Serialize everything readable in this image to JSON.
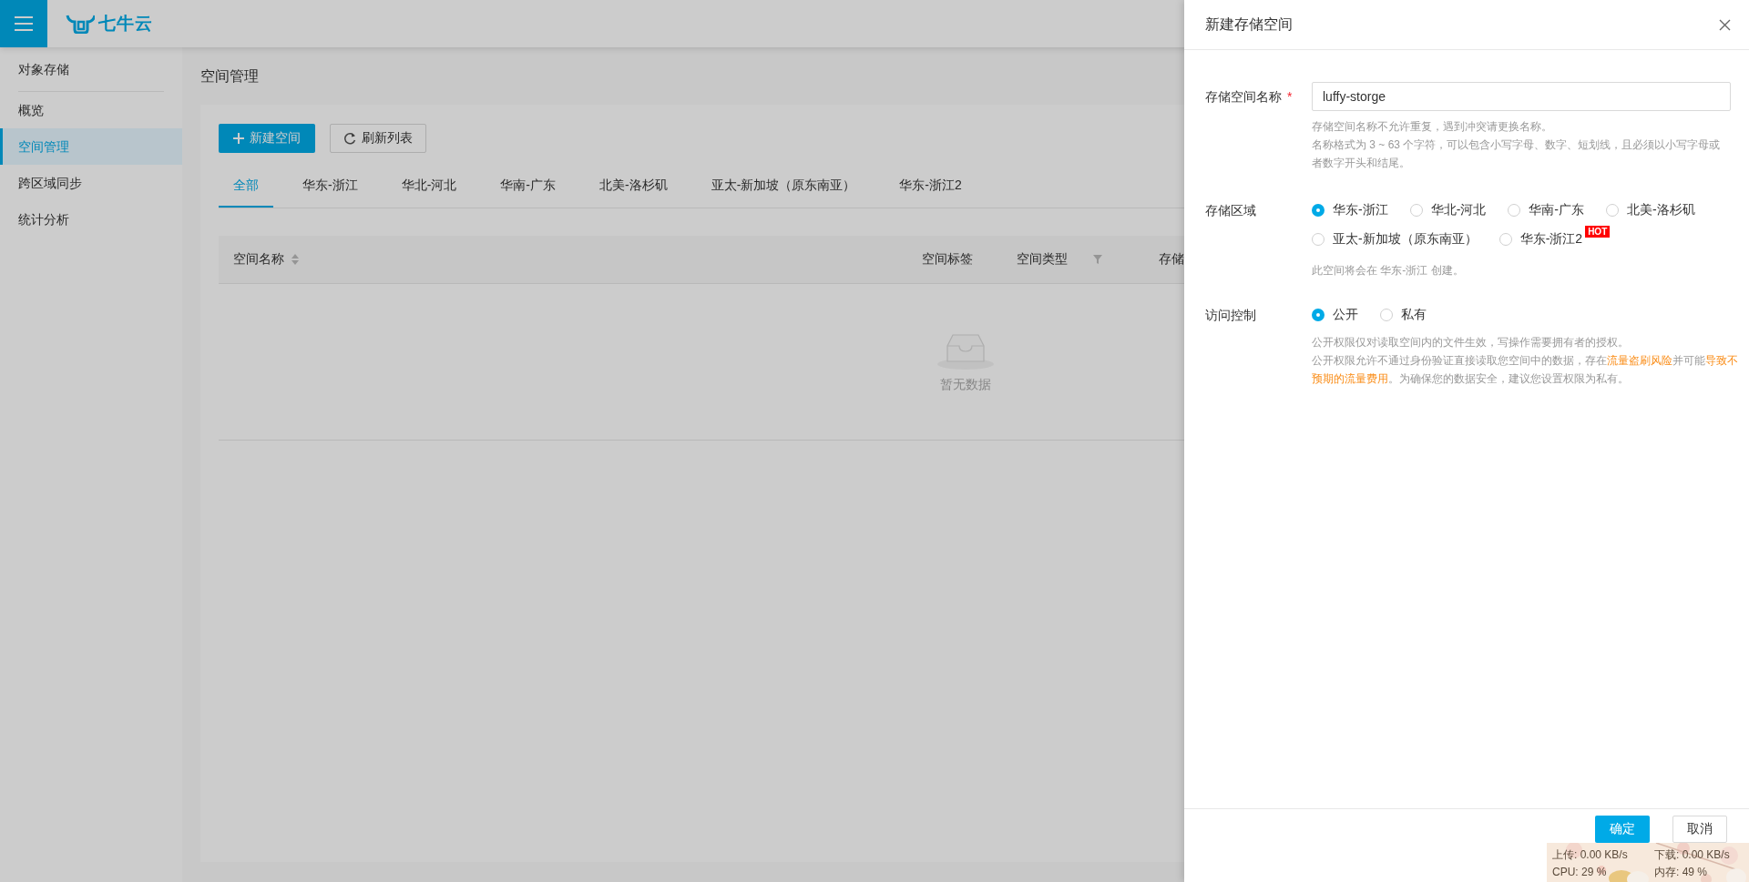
{
  "header": {
    "logo_text": "七牛云"
  },
  "sidebar": {
    "title": "对象存储",
    "items": [
      {
        "label": "概览",
        "selected": false
      },
      {
        "label": "空间管理",
        "selected": true
      },
      {
        "label": "跨区域同步",
        "selected": false
      },
      {
        "label": "统计分析",
        "selected": false
      }
    ]
  },
  "page": {
    "title": "空间管理",
    "buttons": [
      {
        "label": "新建空间",
        "kind": "primary"
      },
      {
        "label": "刷新列表",
        "kind": "refresh"
      }
    ],
    "tabs": [
      {
        "label": "全部",
        "selected": true
      },
      {
        "label": "华东-浙江",
        "selected": false
      },
      {
        "label": "华北-河北",
        "selected": false
      },
      {
        "label": "华南-广东",
        "selected": false
      },
      {
        "label": "北美-洛杉矶",
        "selected": false
      },
      {
        "label": "亚太-新加坡（原东南亚）",
        "selected": false
      },
      {
        "label": "华东-浙江2",
        "selected": false
      }
    ],
    "table": {
      "columns": [
        {
          "label": "空间名称",
          "kind": "sort"
        },
        {
          "label": "空间标签",
          "kind": "plain"
        },
        {
          "label": "空间类型",
          "kind": "filter"
        },
        {
          "label": "存储",
          "kind": "plain"
        }
      ],
      "empty_text": "暂无数据"
    }
  },
  "drawer": {
    "title": "新建存储空间",
    "name_field": {
      "label": "存储空间名称",
      "required_mark": "*",
      "value": "luffy-storge",
      "help": [
        "存储空间名称不允许重复，遇到冲突请更换名称。",
        "名称格式为 3 ~ 63 个字符，可以包含小写字母、数字、短划线，且必须以小写字母或者数字开头和结尾。"
      ]
    },
    "region": {
      "label": "存储区域",
      "options": [
        {
          "label": "华东-浙江",
          "selected": true
        },
        {
          "label": "华北-河北",
          "selected": false
        },
        {
          "label": "华南-广东",
          "selected": false
        },
        {
          "label": "北美-洛杉矶",
          "selected": false
        },
        {
          "label": "亚太-新加坡（原东南亚）",
          "selected": false
        },
        {
          "label": "华东-浙江2",
          "selected": false,
          "badge": "HOT"
        }
      ],
      "note": "此空间将会在 华东-浙江 创建。"
    },
    "access": {
      "label": "访问控制",
      "options": [
        {
          "label": "公开",
          "selected": true
        },
        {
          "label": "私有",
          "selected": false
        }
      ],
      "help": [
        [
          {
            "text": "公开权限仅对读取空间内的文件生效，写操作需要拥有者的授权。",
            "warning": false
          }
        ],
        [
          {
            "text": "公开权限允许不通过身份验证直接读取您空间中的数据，存在",
            "warning": false
          },
          {
            "text": "流量盗刷风险",
            "warning": true
          },
          {
            "text": "并可能",
            "warning": false
          },
          {
            "text": "导致不预期的流量费用",
            "warning": true
          },
          {
            "text": "。为确保您的数据安全，建议您设置权限为私有。",
            "warning": false
          }
        ]
      ]
    },
    "buttons": [
      {
        "label": "确定",
        "kind": "primary"
      },
      {
        "label": "取消",
        "kind": "default"
      }
    ]
  },
  "net_monitor": {
    "upload": "上传: 0.00 KB/s",
    "download": "下载: 0.00 KB/s",
    "cpu": "CPU: 29 %",
    "memory": "内存: 49 %"
  }
}
